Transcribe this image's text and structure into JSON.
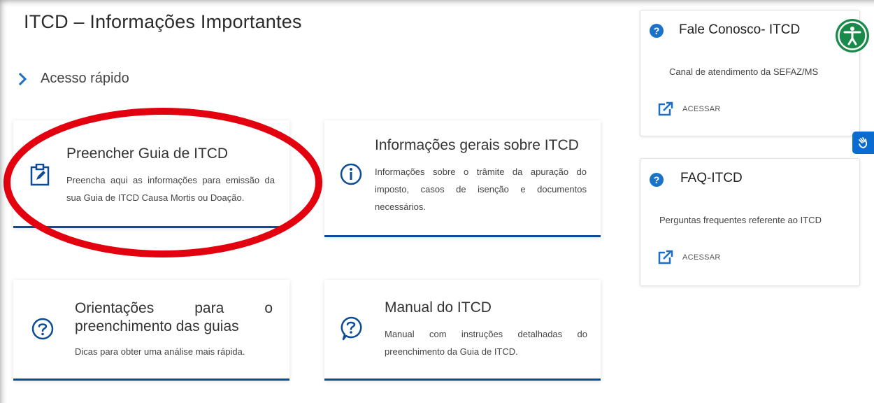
{
  "page": {
    "title": "ITCD – Informações Importantes",
    "quick_access": "Acesso rápido"
  },
  "cards": [
    {
      "title": "Preencher Guia de ITCD",
      "desc": "Preencha aqui as informações para emissão da sua Guia de ITCD Causa Mortis ou Doação.",
      "icon": "edit-clipboard-icon"
    },
    {
      "title": "Informações gerais sobre ITCD",
      "desc": "Informações sobre o trâmite da apuração do imposto, casos de isenção e documentos necessários.",
      "icon": "info-icon"
    },
    {
      "title": "Orientações para o preenchimento das guias",
      "desc": "Dicas para obter uma análise mais rápida.",
      "icon": "question-icon"
    },
    {
      "title": "Manual do ITCD",
      "desc": "Manual com instruções detalhadas do preenchimento da Guia de ITCD.",
      "icon": "question-chat-icon"
    }
  ],
  "sidebar": [
    {
      "title": "Fale Conosco- ITCD",
      "desc": "Canal de atendimento da SEFAZ/MS",
      "link": "ACESSAR"
    },
    {
      "title": "FAQ-ITCD",
      "desc": "Perguntas frequentes referente ao ITCD",
      "link": "ACESSAR"
    }
  ],
  "colors": {
    "accent": "#0c4c96",
    "badge": "#1a73c9",
    "highlight": "#e3000f",
    "accessibility": "#1a8a4a"
  }
}
